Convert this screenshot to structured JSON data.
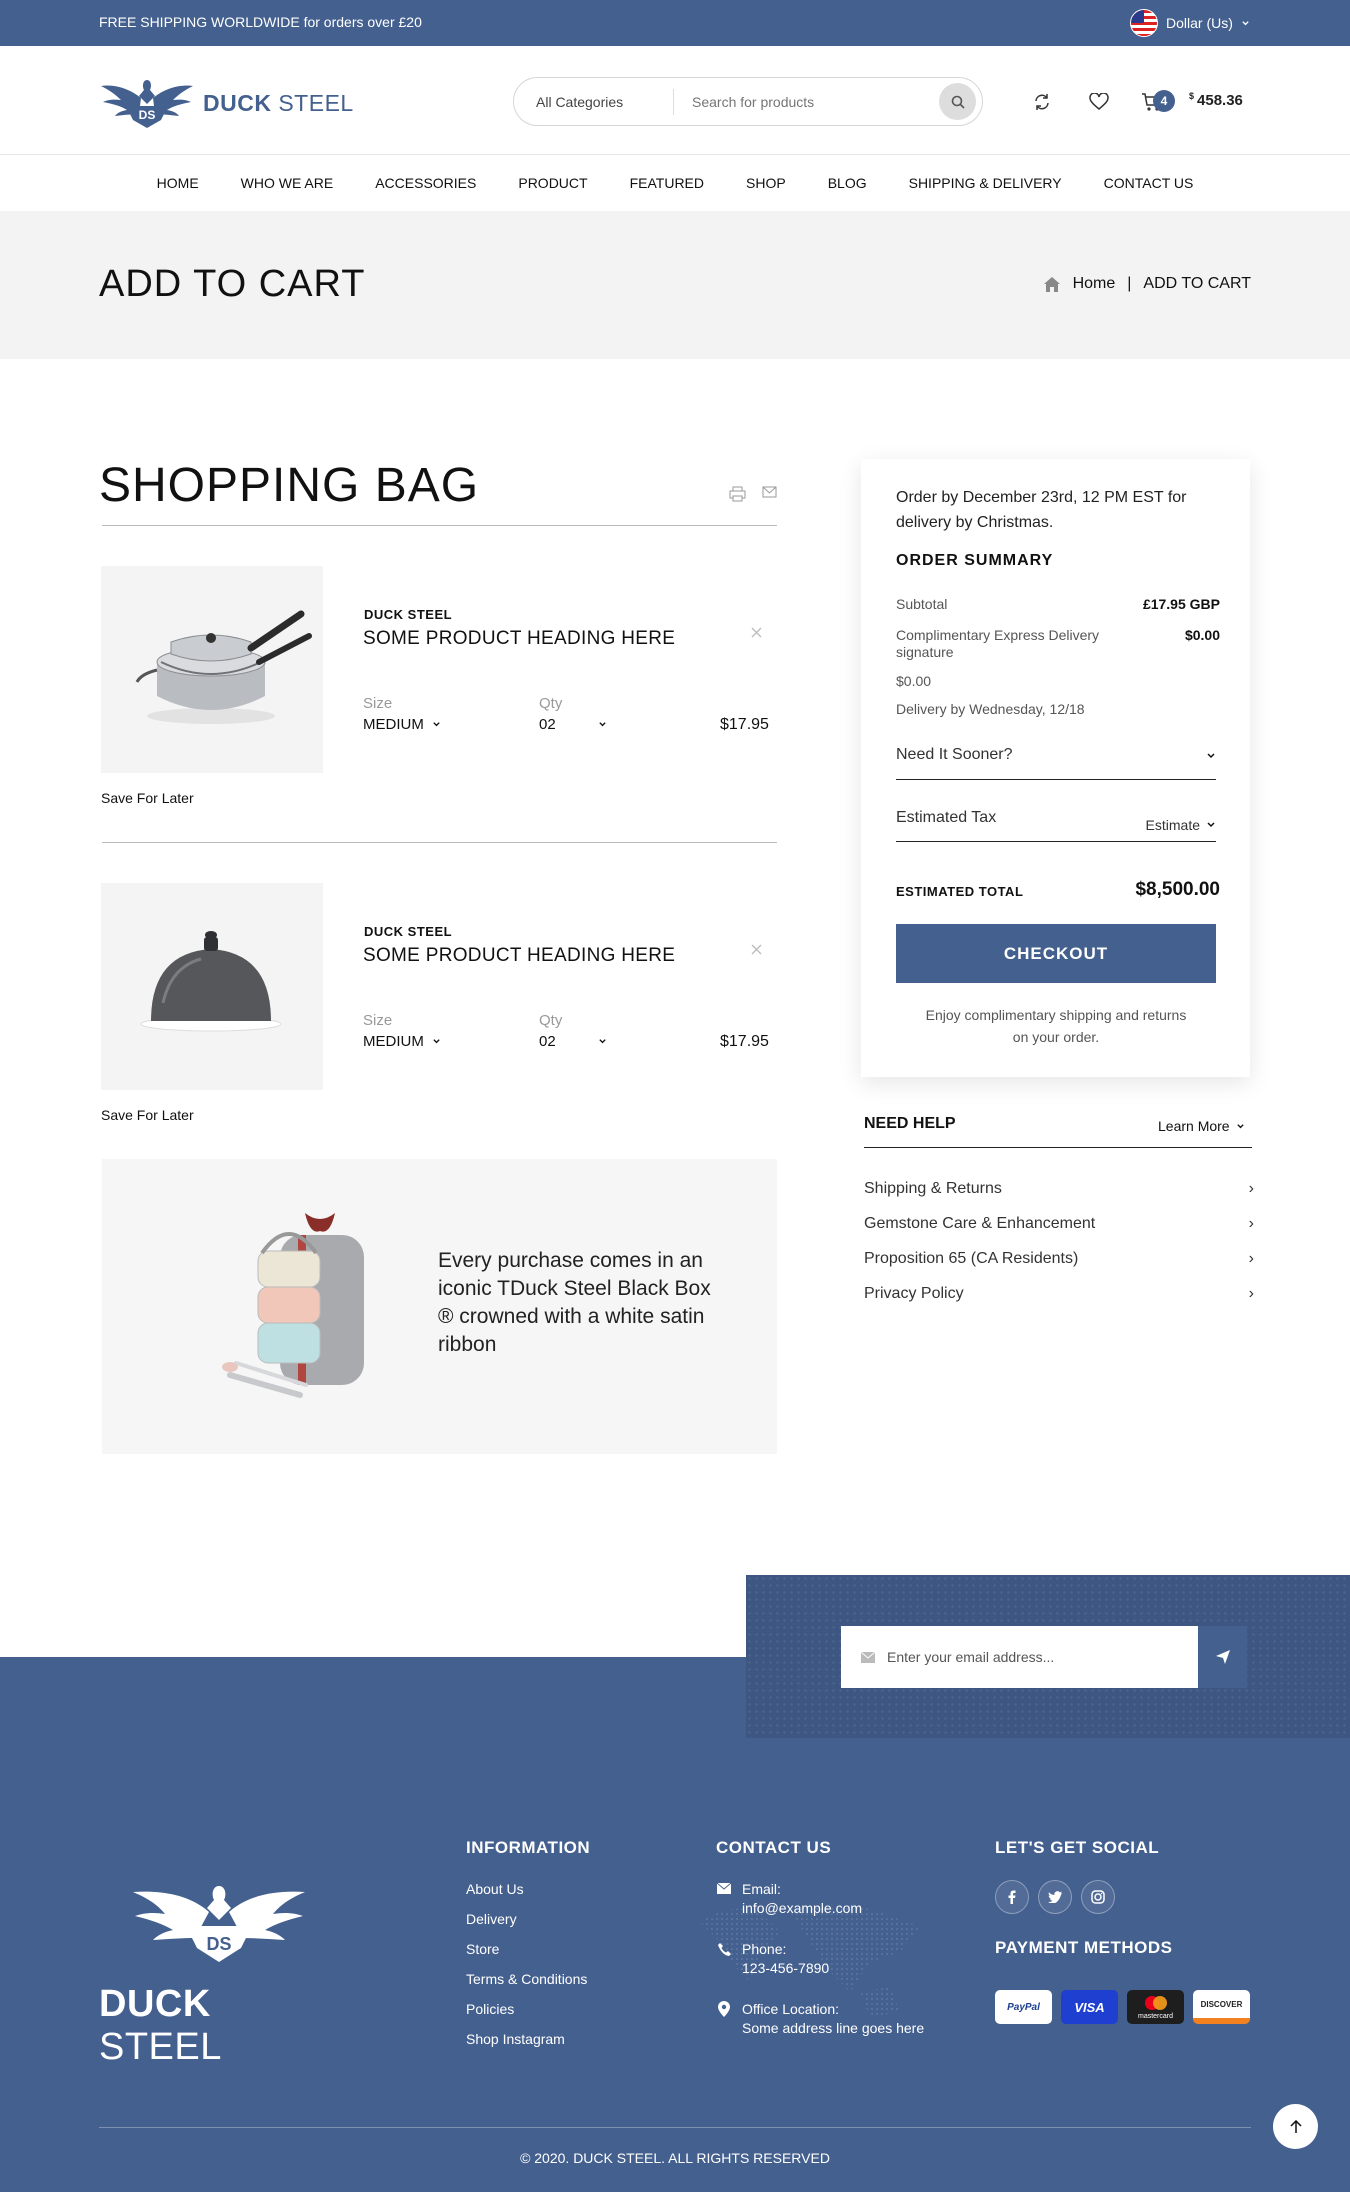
{
  "topbar": {
    "message": "FREE SHIPPING WORLDWIDE for orders over £20",
    "currency": "Dollar (Us)"
  },
  "header": {
    "logo_bold": "DUCK",
    "logo_light": " STEEL",
    "search_category": "All Categories",
    "search_placeholder": "Search for products",
    "cart_count": "4",
    "cart_currency": "$",
    "cart_total": "458.36"
  },
  "nav": [
    "HOME",
    "WHO WE ARE",
    "ACCESSORIES",
    "PRODUCT",
    "FEATURED",
    "SHOP",
    "BLOG",
    "SHIPPING & DELIVERY",
    "CONTACT US"
  ],
  "page": {
    "title": "ADD TO CART",
    "breadcrumb_home": "Home",
    "breadcrumb_sep": "|",
    "breadcrumb_current": "ADD TO CART"
  },
  "bag": {
    "title": "SHOPPING BAG",
    "items": [
      {
        "brand": "DUCK STEEL",
        "name": "SOME PRODUCT HEADING HERE",
        "size_label": "Size",
        "size": "MEDIUM",
        "qty_label": "Qty",
        "qty": "02",
        "price": "$17.95",
        "save": "Save For Later",
        "image": "cookware-set"
      },
      {
        "brand": "DUCK STEEL",
        "name": "SOME PRODUCT HEADING HERE",
        "size_label": "Size",
        "size": "MEDIUM",
        "qty_label": "Qty",
        "qty": "02",
        "price": "$17.95",
        "save": "Save For Later",
        "image": "food-cloche"
      }
    ],
    "promo_text": "Every purchase comes in an iconic TDuck Steel Black Box ® crowned with a white satin ribbon"
  },
  "summary": {
    "notice": "Order by December 23rd, 12 PM EST for delivery by Christmas.",
    "title": "ORDER SUMMARY",
    "subtotal_label": "Subtotal",
    "subtotal": "£17.95 GBP",
    "express_label": "Complimentary Express Delivery signature",
    "express_value": "$0.00",
    "express_price": "$0.00",
    "delivery_by": "Delivery by Wednesday, 12/18",
    "need_sooner": "Need It Sooner?",
    "tax_label": "Estimated Tax",
    "tax_link": "Estimate",
    "total_label": "ESTIMATED TOTAL",
    "total": "$8,500.00",
    "checkout": "CHECKOUT",
    "footnote": "Enjoy complimentary shipping and returns on your order."
  },
  "help": {
    "title": "NEED HELP",
    "learn_more": "Learn More",
    "items": [
      "Shipping & Returns",
      "Gemstone Care & Enhancement",
      "Proposition 65 (CA Residents)",
      "Privacy Policy"
    ]
  },
  "newsletter": {
    "placeholder": "Enter your email address..."
  },
  "footer": {
    "logo_bold": "DUCK",
    "logo_light": " STEEL",
    "info_title": "INFORMATION",
    "info_links": [
      "About Us",
      "Delivery",
      "Store",
      "Terms & Conditions",
      "Policies",
      "Shop Instagram"
    ],
    "contact_title": "CONTACT US",
    "email_label": "Email:",
    "email": "info@example.com",
    "phone_label": "Phone:",
    "phone": "123-456-7890",
    "office_label": "Office Location:",
    "office": "Some address line goes here",
    "social_title": "LET'S GET SOCIAL",
    "payment_title": "PAYMENT METHODS",
    "payments": [
      "PayPal",
      "VISA",
      "mastercard",
      "DISCOVER"
    ],
    "copyright": "© 2020. DUCK STEEL. ALL RIGHTS RESERVED"
  },
  "colors": {
    "brand": "#44608f",
    "footer_dark": "#3d5782",
    "band": "#f3f3f3"
  }
}
